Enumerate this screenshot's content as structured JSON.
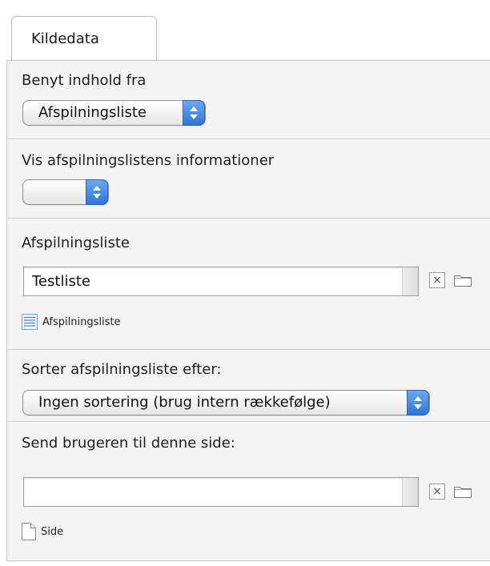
{
  "tab": {
    "label": "Kildedata"
  },
  "content_source": {
    "label": "Benyt indhold fra",
    "selected": "Afspilningsliste"
  },
  "playlist_info": {
    "label": "Vis afspilningslistens informationer",
    "selected": ""
  },
  "playlist": {
    "label": "Afspilningsliste",
    "value": "Testliste",
    "clear_symbol": "×",
    "record_link": "Afspilningsliste"
  },
  "sort": {
    "label": "Sorter afspilningsliste efter:",
    "selected": "Ingen sortering (brug intern rækkefølge)"
  },
  "redirect": {
    "label": "Send brugeren til denne side:",
    "value": "",
    "clear_symbol": "×",
    "record_link": "Side"
  },
  "icons": {
    "clear": "clear-icon",
    "folder": "folder-icon",
    "list": "list-record-icon",
    "page": "page-record-icon"
  }
}
